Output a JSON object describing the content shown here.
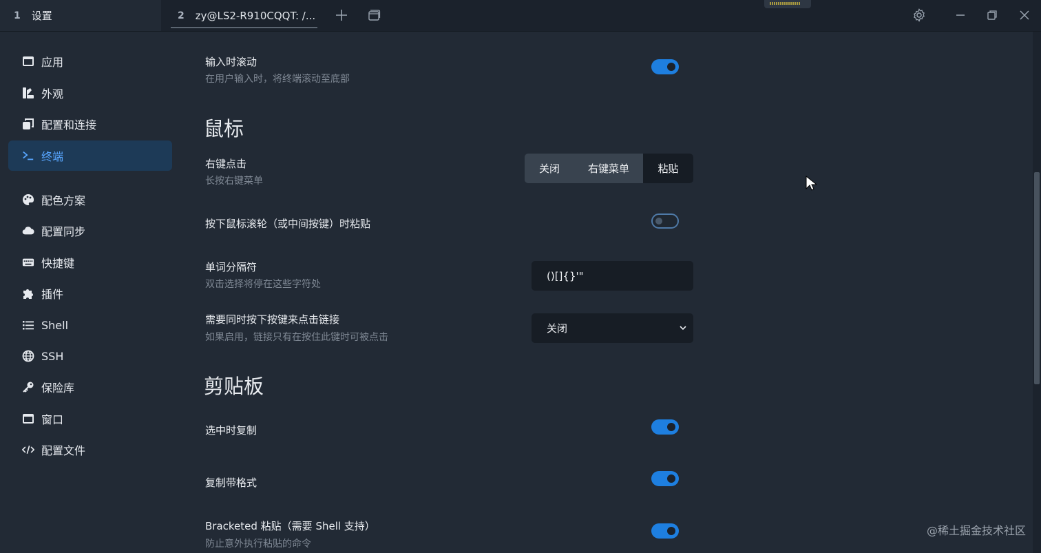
{
  "tabs": [
    {
      "num": "1",
      "label": "设置"
    },
    {
      "num": "2",
      "label": "zy@LS2-R910CQQT: /..."
    }
  ],
  "icons": {
    "new_tab": "plus-icon",
    "tab_list": "window-stack-icon",
    "settings": "gear-icon",
    "minimize": "minimize-icon",
    "restore": "restore-icon",
    "close": "close-icon"
  },
  "sidebar": {
    "items": [
      {
        "label": "应用",
        "icon": "app-window-icon"
      },
      {
        "label": "外观",
        "icon": "appearance-icon"
      },
      {
        "label": "配置和连接",
        "icon": "profiles-icon"
      },
      {
        "label": "终端",
        "icon": "terminal-icon",
        "active": true
      },
      {
        "label": "配色方案",
        "icon": "palette-icon"
      },
      {
        "label": "配置同步",
        "icon": "cloud-icon"
      },
      {
        "label": "快捷键",
        "icon": "keyboard-icon"
      },
      {
        "label": "插件",
        "icon": "puzzle-icon"
      },
      {
        "label": "Shell",
        "icon": "list-icon"
      },
      {
        "label": "SSH",
        "icon": "globe-icon"
      },
      {
        "label": "保险库",
        "icon": "key-icon"
      },
      {
        "label": "窗口",
        "icon": "window-icon"
      },
      {
        "label": "配置文件",
        "icon": "code-icon"
      }
    ]
  },
  "settings": {
    "scroll_on_input": {
      "title": "输入时滚动",
      "desc": "在用户输入时，将终端滚动至底部",
      "enabled": true
    },
    "mouse_section": "鼠标",
    "right_click": {
      "title": "右键点击",
      "desc": "长按右键菜单",
      "options": [
        "关闭",
        "右键菜单",
        "粘贴"
      ],
      "selected": "粘贴"
    },
    "middle_click_paste": {
      "title": "按下鼠标滚轮（或中间按键）时粘贴",
      "enabled": false
    },
    "word_separators": {
      "title": "单词分隔符",
      "desc": "双击选择将停在这些字符处",
      "value": "()[]{}'\""
    },
    "link_modifier": {
      "title": "需要同时按下按键来点击链接",
      "desc": "如果启用，链接只有在按住此键时可被点击",
      "value": "关闭"
    },
    "clipboard_section": "剪贴板",
    "copy_on_select": {
      "title": "选中时复制",
      "enabled": true
    },
    "copy_with_formatting": {
      "title": "复制带格式",
      "enabled": true
    },
    "bracketed_paste": {
      "title": "Bracketed 粘贴（需要 Shell 支持）",
      "desc": "防止意外执行粘贴的命令",
      "enabled": true
    }
  },
  "watermark": "@稀土掘金技术社区",
  "colors": {
    "accent": "#1e7fe0",
    "active_nav_bg": "#1d3a57",
    "active_nav_text": "#58a6ff"
  }
}
